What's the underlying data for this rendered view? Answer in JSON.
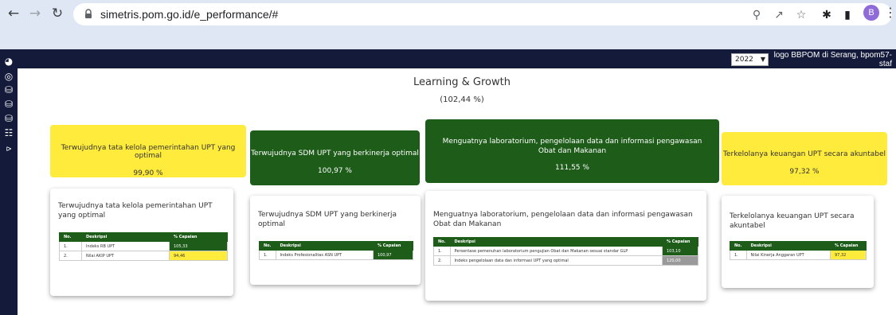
{
  "browser": {
    "url": "simetris.pom.go.id/e_performance/#",
    "profile_initial": "B"
  },
  "header": {
    "year": "2022",
    "logo_alt": "logo BBPOM di Serang, bpom57-staf"
  },
  "page": {
    "title": "Learning & Growth",
    "percentage": "(102,44 %)"
  },
  "kpis": [
    {
      "title": "Terwujudnya tata kelola pemerintahan UPT yang optimal",
      "value": "99,90 %",
      "color": "#ffeb3b"
    },
    {
      "title": "Terwujudnya SDM UPT yang berkinerja optimal",
      "value": "100,97 %",
      "color": "#1e5c1a"
    },
    {
      "title": "Menguatnya laboratorium, pengelolaan data dan informasi pengawasan Obat dan Makanan",
      "value": "111,55 %",
      "color": "#1e5c1a"
    },
    {
      "title": "Terkelolanya keuangan UPT secara akuntabel",
      "value": "97,32 %",
      "color": "#ffeb3b"
    }
  ],
  "table_headers": {
    "no": "No.",
    "deskripsi": "Deskripsi",
    "capaian": "% Capaian"
  },
  "cards": [
    {
      "title": "Terwujudnya tata kelola pemerintahan UPT yang optimal",
      "rows": [
        {
          "no": "1.",
          "deskripsi": "Indeks RB UPT",
          "capaian": "105,33",
          "status": "green"
        },
        {
          "no": "2.",
          "deskripsi": "Nilai AKIP UPT",
          "capaian": "94,46",
          "status": "yellow"
        }
      ]
    },
    {
      "title": "Terwujudnya SDM UPT yang berkinerja optimal",
      "rows": [
        {
          "no": "1.",
          "deskripsi": "Indeks Profesionalitas ASN UPT",
          "capaian": "100,97",
          "status": "green"
        }
      ]
    },
    {
      "title": "Menguatnya laboratorium, pengelolaan data dan informasi pengawasan Obat dan Makanan",
      "rows": [
        {
          "no": "1.",
          "deskripsi": "Persentase pemenuhan laboratorium pengujian Obat dan Makanan sesuai standar GLP",
          "capaian": "103,10",
          "status": "green"
        },
        {
          "no": "2.",
          "deskripsi": "Indeks pengelolaan data dan informasi UPT yang optimal",
          "capaian": "120,00",
          "status": "gray"
        }
      ]
    },
    {
      "title": "Terkelolanya keuangan UPT secara akuntabel",
      "rows": [
        {
          "no": "1.",
          "deskripsi": "Nilai Kinerja Anggaran UPT",
          "capaian": "97,32",
          "status": "yellow"
        }
      ]
    }
  ]
}
